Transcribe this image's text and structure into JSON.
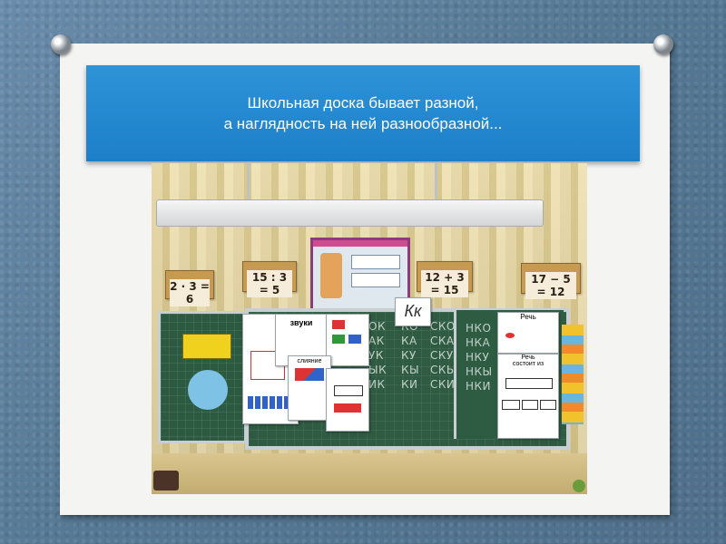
{
  "slide": {
    "title_line1": "Школьная доска бывает разной,",
    "title_line2": "а наглядность на ней разнообразной..."
  },
  "photo": {
    "signs": [
      {
        "eq": "2 · 3 = 6"
      },
      {
        "eq": "15 : 3 = 5"
      },
      {
        "eq": "12 + 3 = 15"
      },
      {
        "eq": "17 − 5 = 12"
      }
    ],
    "letter_card": "Кк",
    "chalk_col1": [
      "ОК",
      "АК",
      "УК",
      "ЫК",
      "ИК"
    ],
    "chalk_col2": [
      "КО",
      "КА",
      "КУ",
      "КЫ",
      "КИ"
    ],
    "chalk_col3": [
      "СКО",
      "СКА",
      "СКУ",
      "СКЫ",
      "СКИ"
    ],
    "chalk_col4": [
      "НКО",
      "НКА",
      "НКУ",
      "НКЫ",
      "НКИ"
    ],
    "card_words": {
      "zvuki": "звуки",
      "sliyanie": "слияние",
      "rech1": "Речь",
      "rech2": "Речь",
      "rech_sub": "состоит из"
    }
  },
  "colors": {
    "banner": "#1c7fc8",
    "board": "#2f5b42",
    "paper": "#f4f4f2",
    "background": "#5d7f9c"
  }
}
